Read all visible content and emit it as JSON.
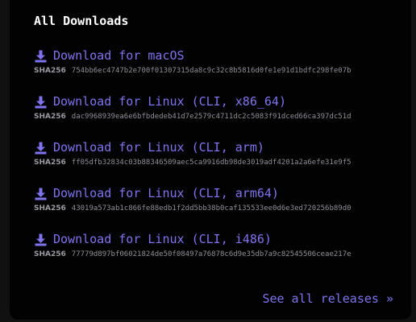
{
  "heading": "All Downloads",
  "sha_tag": "SHA256",
  "downloads": [
    {
      "label": "Download for macOS",
      "sha256": "754bb6ec4747b2e700f01307315da8c9c32c8b5816d0fe1e91d1bdfc298fe07b"
    },
    {
      "label": "Download for Linux (CLI, x86_64)",
      "sha256": "dac9968939ea6e6bfbdedeb41d7e2579c4711dc2c5083f91dced66ca397dc51d"
    },
    {
      "label": "Download for Linux (CLI, arm)",
      "sha256": "ff05dfb32834c03b88346509aec5ca9916db98de3019adf4201a2a6efe31e9f5"
    },
    {
      "label": "Download for Linux (CLI, arm64)",
      "sha256": "43019a573ab1c866fe88edb1f2dd5bb38b0caf135533ee0d6e3ed720256b89d0"
    },
    {
      "label": "Download for Linux (CLI, i486)",
      "sha256": "77779d897bf06021824de50f08497a76878c6d9e35db7a9c82545506ceae217e"
    }
  ],
  "see_all": "See all releases »",
  "colors": {
    "accent": "#7f73ee",
    "background": "#020202",
    "text_muted": "#8f8f98"
  },
  "icons": {
    "download": "download-icon"
  }
}
